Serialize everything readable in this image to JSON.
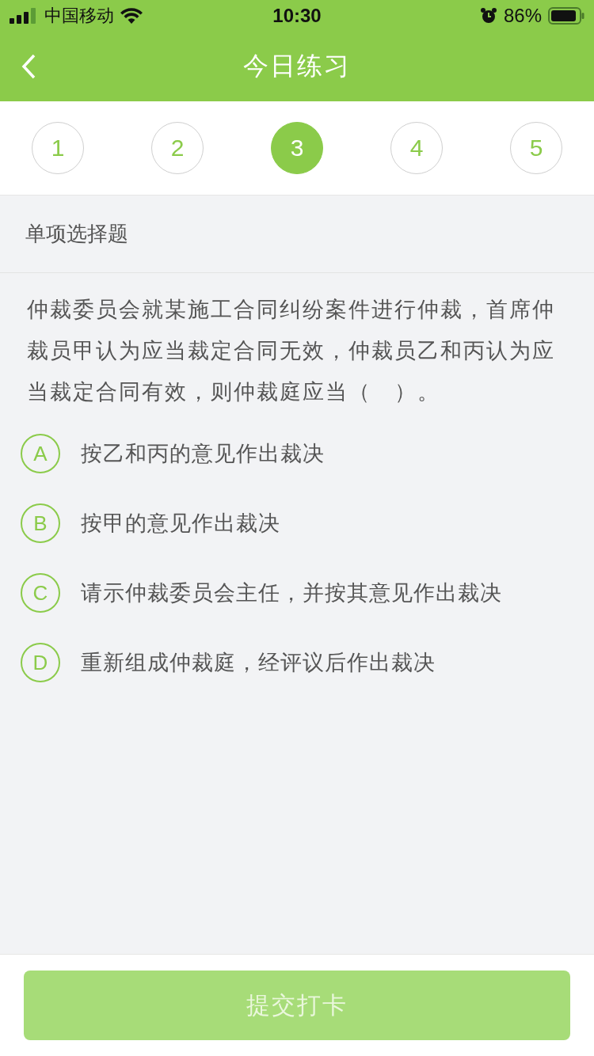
{
  "status_bar": {
    "carrier": "中国移动",
    "time": "10:30",
    "battery": "86%"
  },
  "nav": {
    "title": "今日练习"
  },
  "steps": [
    {
      "label": "1",
      "selected": false
    },
    {
      "label": "2",
      "selected": false
    },
    {
      "label": "3",
      "selected": true
    },
    {
      "label": "4",
      "selected": false
    },
    {
      "label": "5",
      "selected": false
    }
  ],
  "question": {
    "type": "单项选择题",
    "text": "仲裁委员会就某施工合同纠纷案件进行仲裁，首席仲裁员甲认为应当裁定合同无效，仲裁员乙和丙认为应当裁定合同有效，则仲裁庭应当（　）。",
    "options": [
      {
        "letter": "A",
        "text": "按乙和丙的意见作出裁决",
        "selected": false
      },
      {
        "letter": "B",
        "text": "按甲的意见作出裁决",
        "selected": false
      },
      {
        "letter": "C",
        "text": "请示仲裁委员会主任，并按其意见作出裁决",
        "selected": false
      },
      {
        "letter": "D",
        "text": "重新组成仲裁庭，经评议后作出裁决",
        "selected": false
      }
    ]
  },
  "submit": {
    "label": "提交打卡",
    "disabled": true
  }
}
